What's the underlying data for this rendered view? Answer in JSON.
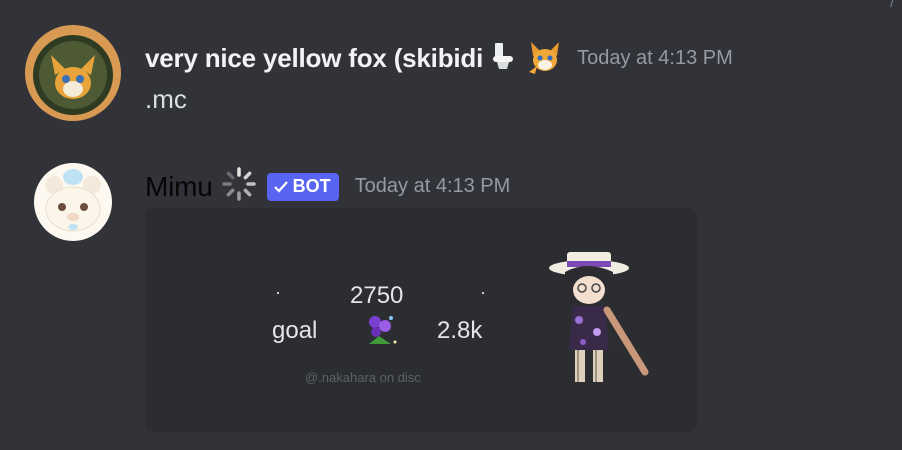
{
  "messages": [
    {
      "username": "very nice yellow fox (skibidi",
      "name_icons": [
        "toilet-emoji-icon",
        "fox-emoji-icon"
      ],
      "timestamp": "Today at 4:13 PM",
      "content": ".mc",
      "avatar": "fox-avatar-icon"
    },
    {
      "username": "Mimu",
      "badge": "BOT",
      "name_icons": [
        "loading-spinner-icon"
      ],
      "timestamp": "Today at 4:13 PM",
      "avatar": "bear-avatar-icon"
    }
  ],
  "embed": {
    "current_value": "2750",
    "goal_label": "goal",
    "goal_value": "2.8k",
    "separator": "·",
    "watermark": "@.nakahara on disc",
    "decor_icons": [
      "violet-flower-icon",
      "hat-character-icon"
    ]
  },
  "colors": {
    "background": "#313338",
    "embed_background": "#2b2d31",
    "bot_badge": "#5865f2",
    "timestamp": "#949ba4"
  }
}
